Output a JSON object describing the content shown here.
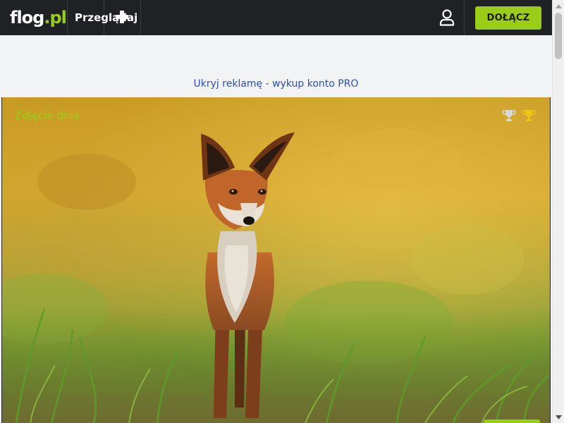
{
  "header": {
    "logo": {
      "main": "flog",
      "dot": ".",
      "tld": "pl"
    },
    "browse_label": "Przeglądaj",
    "add_icon": "plus-icon",
    "user_icon": "user-icon",
    "join_label": "DOŁĄCZ"
  },
  "ad": {
    "link_text": "Ukryj reklamę - wykup konto PRO"
  },
  "photo_of_day": {
    "label": "Zdjęcie dnia",
    "subject": "red fox standing in grass",
    "icons": [
      "trophy-silver-icon",
      "trophy-gold-icon"
    ]
  },
  "colors": {
    "nav_bg": "#202124",
    "accent": "#9acd17",
    "link": "#2f4fb0",
    "ad_bg": "#f2f3f5"
  }
}
